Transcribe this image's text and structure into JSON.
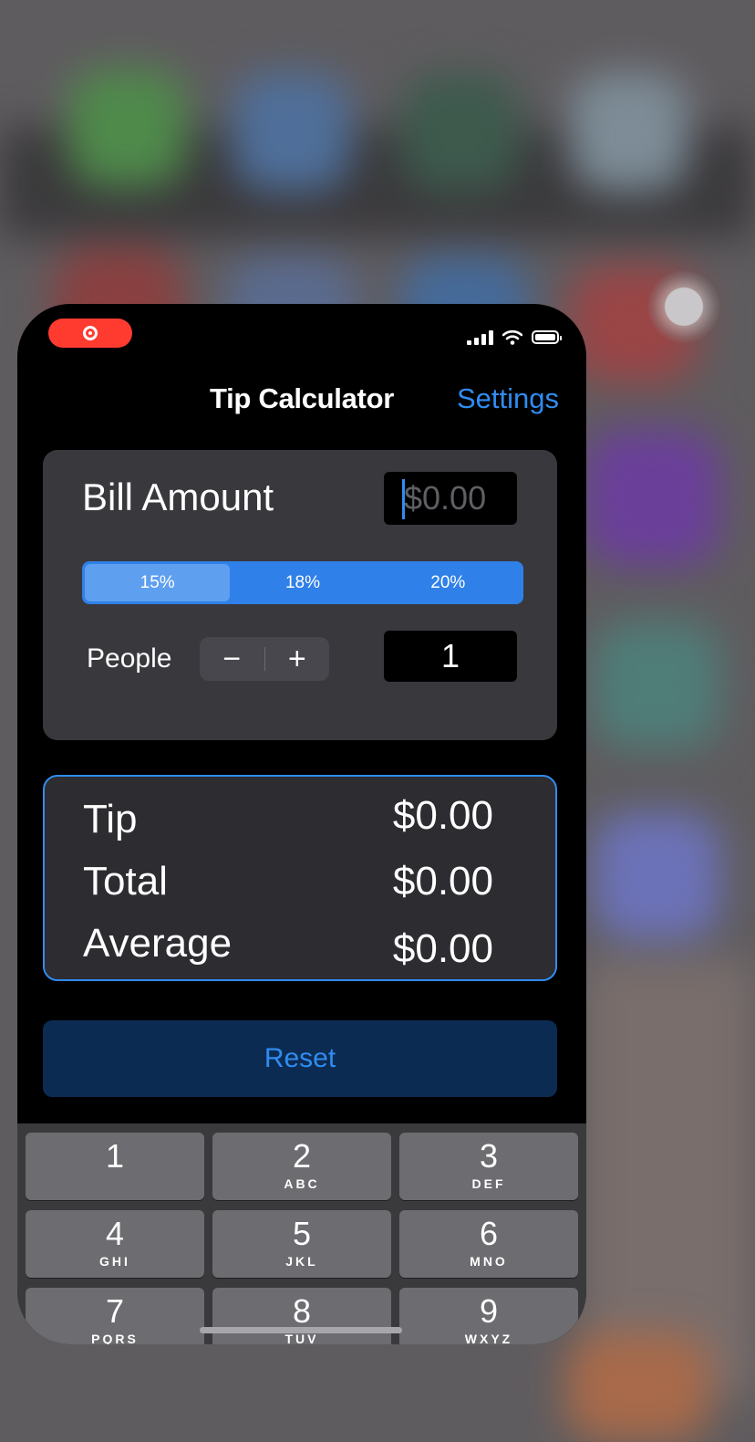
{
  "status_bar": {
    "recording": true,
    "icons": [
      "recording-icon",
      "signal-icon",
      "wifi-icon",
      "battery-icon"
    ]
  },
  "nav": {
    "title": "Tip Calculator",
    "action": "Settings"
  },
  "bill": {
    "label": "Bill Amount",
    "placeholder": "$0.00",
    "value": ""
  },
  "tip_options": [
    {
      "label": "15%",
      "selected": true
    },
    {
      "label": "18%",
      "selected": false
    },
    {
      "label": "20%",
      "selected": false
    }
  ],
  "people": {
    "label": "People",
    "decrement": "−",
    "increment": "+",
    "value": "1"
  },
  "results": [
    {
      "label": "Tip",
      "value": "$0.00"
    },
    {
      "label": "Total",
      "value": "$0.00"
    },
    {
      "label": "Average",
      "value": "$0.00"
    }
  ],
  "reset_label": "Reset",
  "keypad": [
    {
      "num": "1",
      "letters": ""
    },
    {
      "num": "2",
      "letters": "ABC"
    },
    {
      "num": "3",
      "letters": "DEF"
    },
    {
      "num": "4",
      "letters": "GHI"
    },
    {
      "num": "5",
      "letters": "JKL"
    },
    {
      "num": "6",
      "letters": "MNO"
    },
    {
      "num": "7",
      "letters": "PQRS"
    },
    {
      "num": "8",
      "letters": "TUV"
    },
    {
      "num": "9",
      "letters": "WXYZ"
    }
  ],
  "colors": {
    "accent": "#2f8cf0",
    "card": "#39383d",
    "result_card": "#2d2c31",
    "recording": "#ff3b30",
    "reset_bg": "#0c2b52"
  }
}
